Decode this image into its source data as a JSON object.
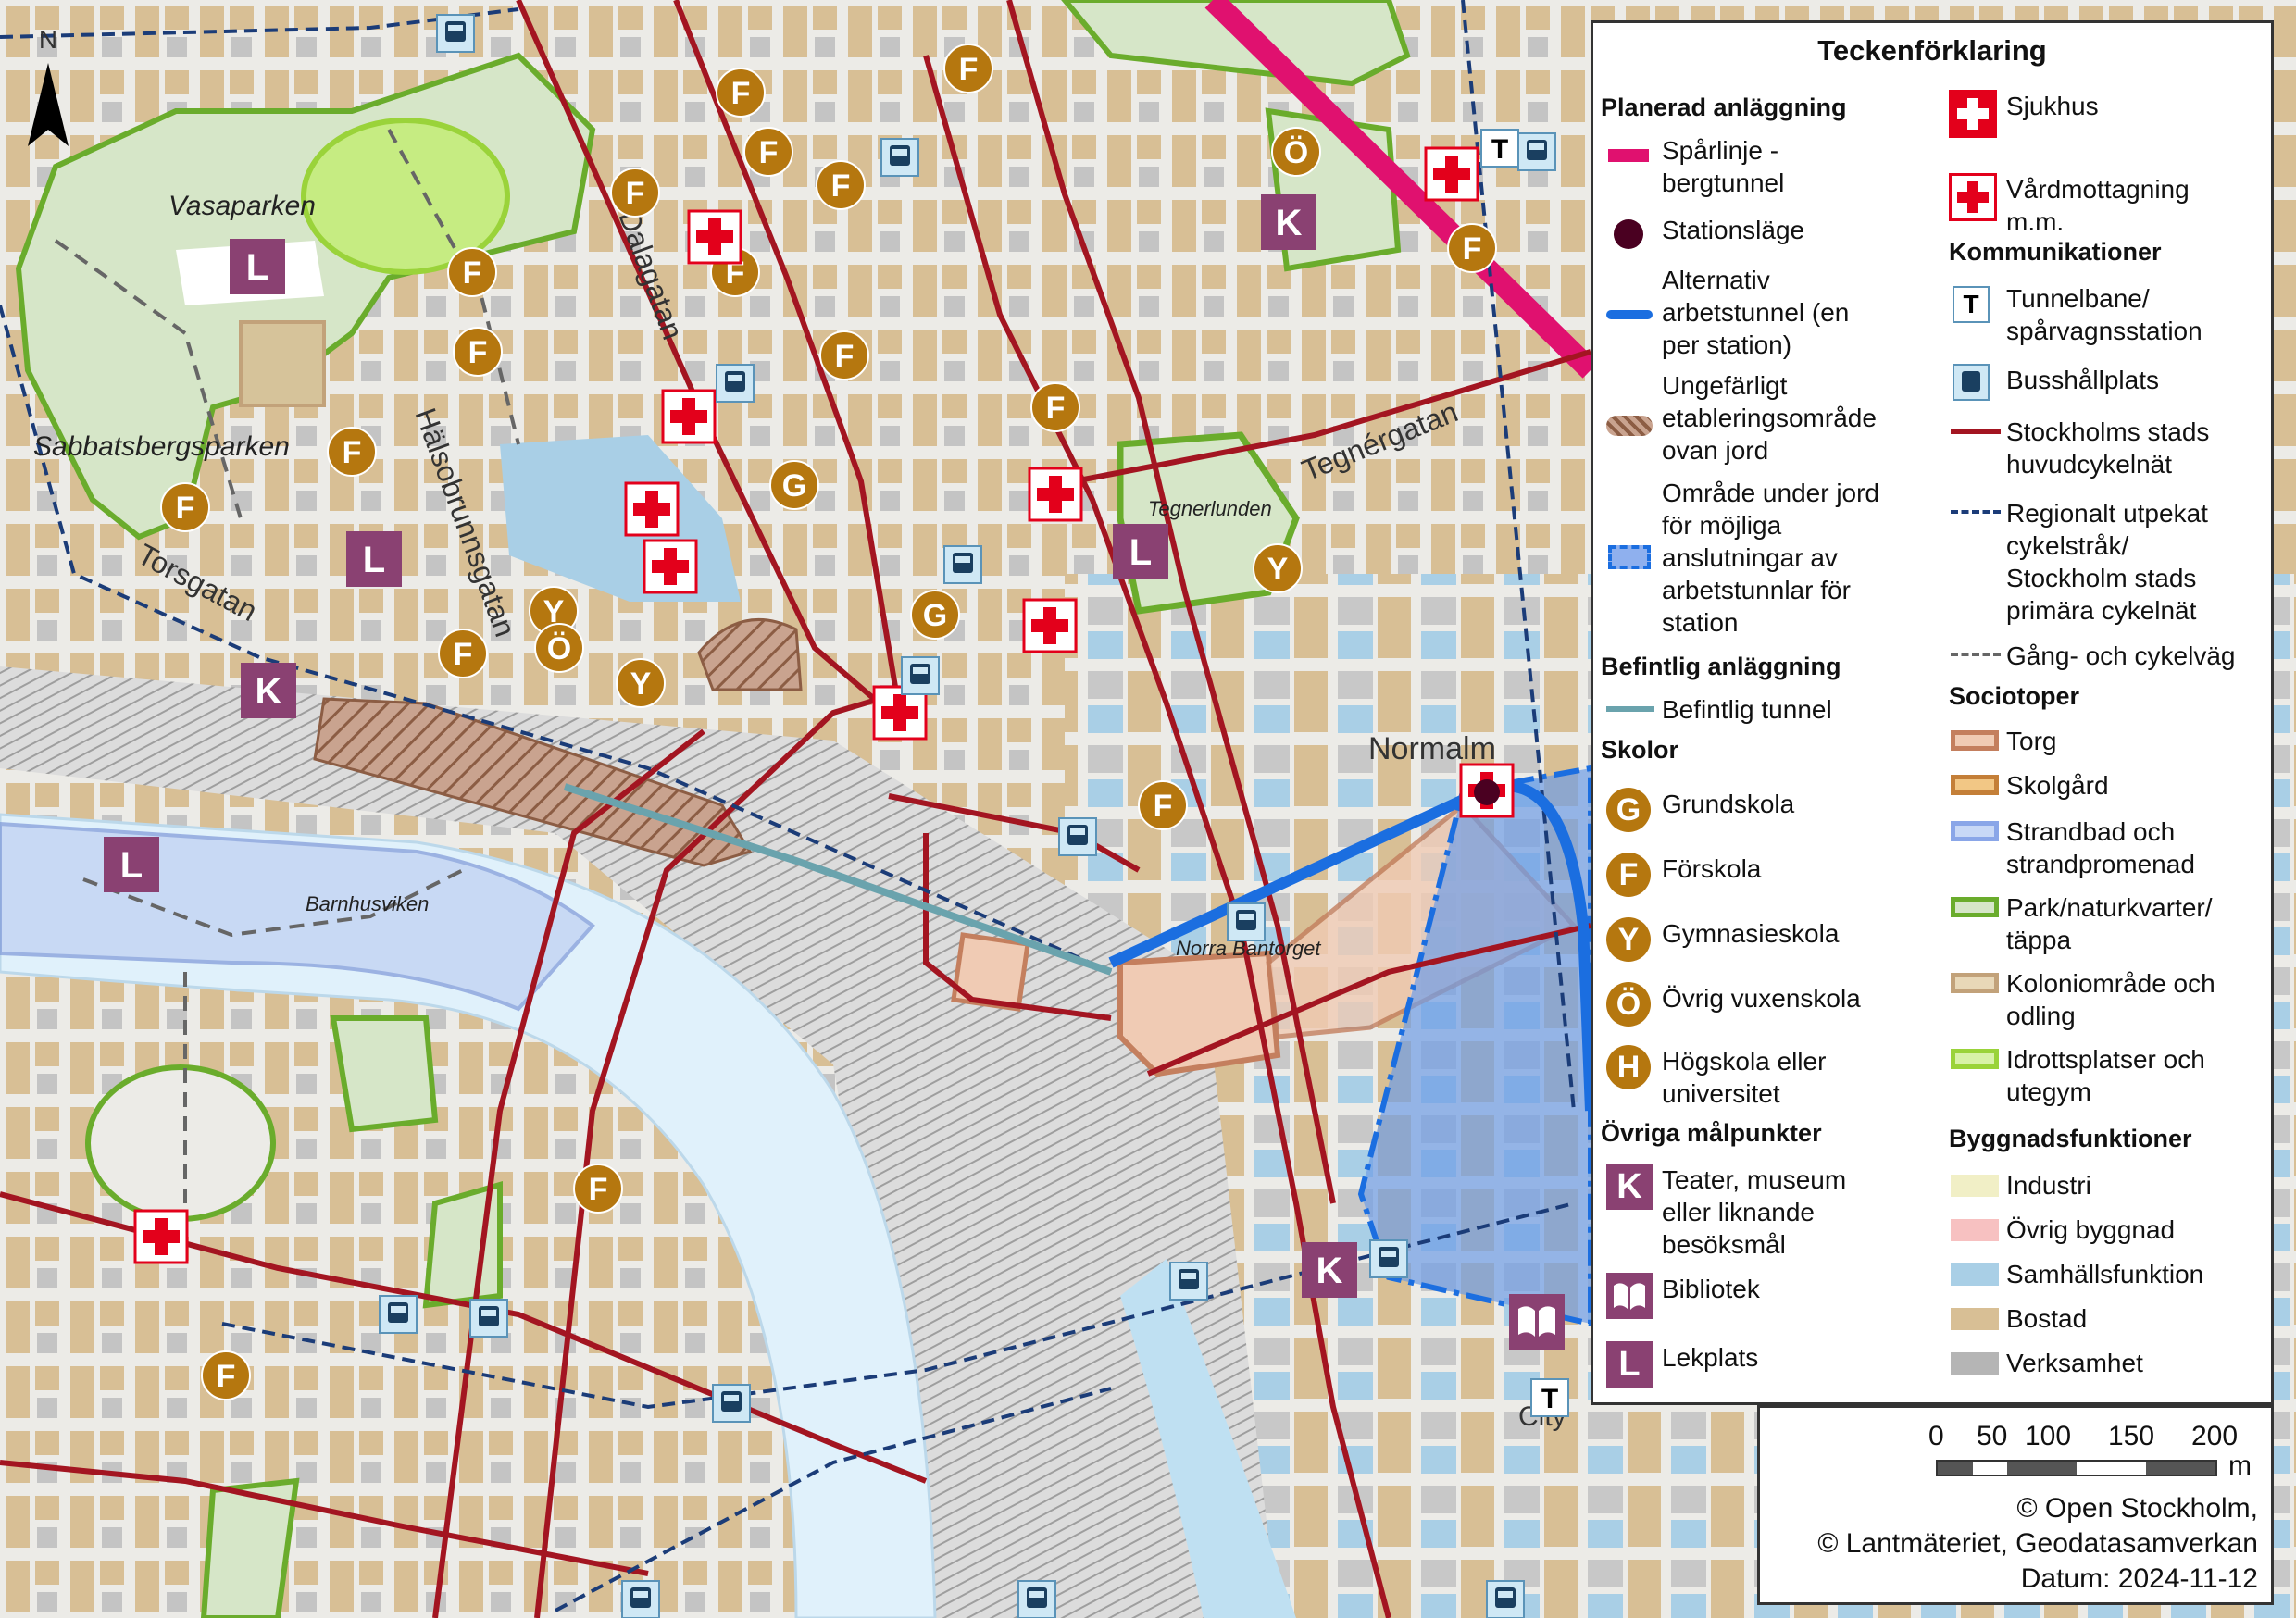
{
  "legend": {
    "title": "Teckenförklaring",
    "planned_head": "Planerad anläggning",
    "items_planned": [
      {
        "label": "Spårlinje -\nbergtunnel"
      },
      {
        "label": "Stationsläge"
      },
      {
        "label": "Alternativ\narbetstunnel (en\nper station)"
      },
      {
        "label": "Ungefärligt\netableringsområde\novan jord"
      },
      {
        "label": "Område under jord\nför möjliga\nanslutningar av\narbetstunnlar för\nstation"
      }
    ],
    "existing_head": "Befintlig anläggning",
    "existing_item": "Befintlig tunnel",
    "schools_head": "Skolor",
    "schools": [
      {
        "letter": "G",
        "label": "Grundskola"
      },
      {
        "letter": "F",
        "label": "Förskola"
      },
      {
        "letter": "Y",
        "label": "Gymnasieskola"
      },
      {
        "letter": "Ö",
        "label": "Övrig vuxenskola"
      },
      {
        "letter": "H",
        "label": "Högskola eller\nuniversitet"
      }
    ],
    "other_head": "Övriga målpunkter",
    "other": [
      {
        "letter": "K",
        "label": "Teater, museum\neller liknande\nbesöksmål"
      },
      {
        "letter": "",
        "label": "Bibliotek"
      },
      {
        "letter": "L",
        "label": "Lekplats"
      }
    ],
    "health": [
      {
        "label": "Sjukhus"
      },
      {
        "label": "Vårdmottagning\nm.m."
      }
    ],
    "comm_head": "Kommunikationer",
    "comm": [
      {
        "glyph": "T",
        "label": "Tunnelbane/\nspårvagnsstation"
      },
      {
        "label": "Busshållplats"
      },
      {
        "label": "Stockholms stads\nhuvudcykelnät"
      },
      {
        "label": "Regionalt utpekat\ncykelstråk/\nStockholm stads\nprimära cykelnät"
      },
      {
        "label": "Gång- och cykelväg"
      }
    ],
    "socio_head": "Sociotoper",
    "socio": [
      {
        "label": "Torg"
      },
      {
        "label": "Skolgård"
      },
      {
        "label": "Strandbad och\nstrandpromenad"
      },
      {
        "label": "Park/naturkvarter/\ntäppa"
      },
      {
        "label": "Koloniområde och\nodling"
      },
      {
        "label": "Idrottsplatser och\nutegym"
      }
    ],
    "build_head": "Byggnadsfunktioner",
    "buildings": [
      {
        "label": "Industri",
        "color": "#f1efc6"
      },
      {
        "label": "Övrig byggnad",
        "color": "#f7c1c1"
      },
      {
        "label": "Samhällsfunktion",
        "color": "#a9cfe6"
      },
      {
        "label": "Bostad",
        "color": "#d8bf95"
      },
      {
        "label": "Verksamhet",
        "color": "#b5b5b5"
      }
    ]
  },
  "scale": {
    "ticks": [
      "0",
      "50",
      "100",
      "150",
      "200"
    ],
    "unit": "m"
  },
  "credits": {
    "line1": "© Open Stockholm,",
    "line2": "© Lantmäteriet, Geodatasamverkan",
    "line3": "Datum: 2024-11-12"
  },
  "map": {
    "north": "N",
    "places": {
      "vasaparken": "Vasaparken",
      "sabbatsbergsparken": "Sabbatsbergsparken",
      "tegnerlunden": "Tegnerlunden",
      "barnhusviken": "Barnhusviken",
      "norra_bantorget": "Norra Bantorget",
      "normalm": "Normalm",
      "city": "City"
    },
    "streets": {
      "dalagatan": "Dalagatan",
      "halsobrunnsgatan": "Hälsobrunnsgatan",
      "torsgatan": "Torsgatan",
      "tegnergatan": "Tegnérgatan"
    }
  },
  "colors": {
    "railway": "#e0116f",
    "main_cycle": "#a31521",
    "work_tunnel": "#1b6ee0",
    "existing_tunnel": "#6aa3ad",
    "park": "#6aac2c",
    "water": "#e0f1fb",
    "school_badge": "#b5770f",
    "poi_badge": "#8a4172",
    "health": "#e3001b"
  },
  "icons": [
    "north-arrow-icon",
    "hospital-cross-icon",
    "bus-stop-icon",
    "metro-t-icon",
    "library-book-icon"
  ]
}
